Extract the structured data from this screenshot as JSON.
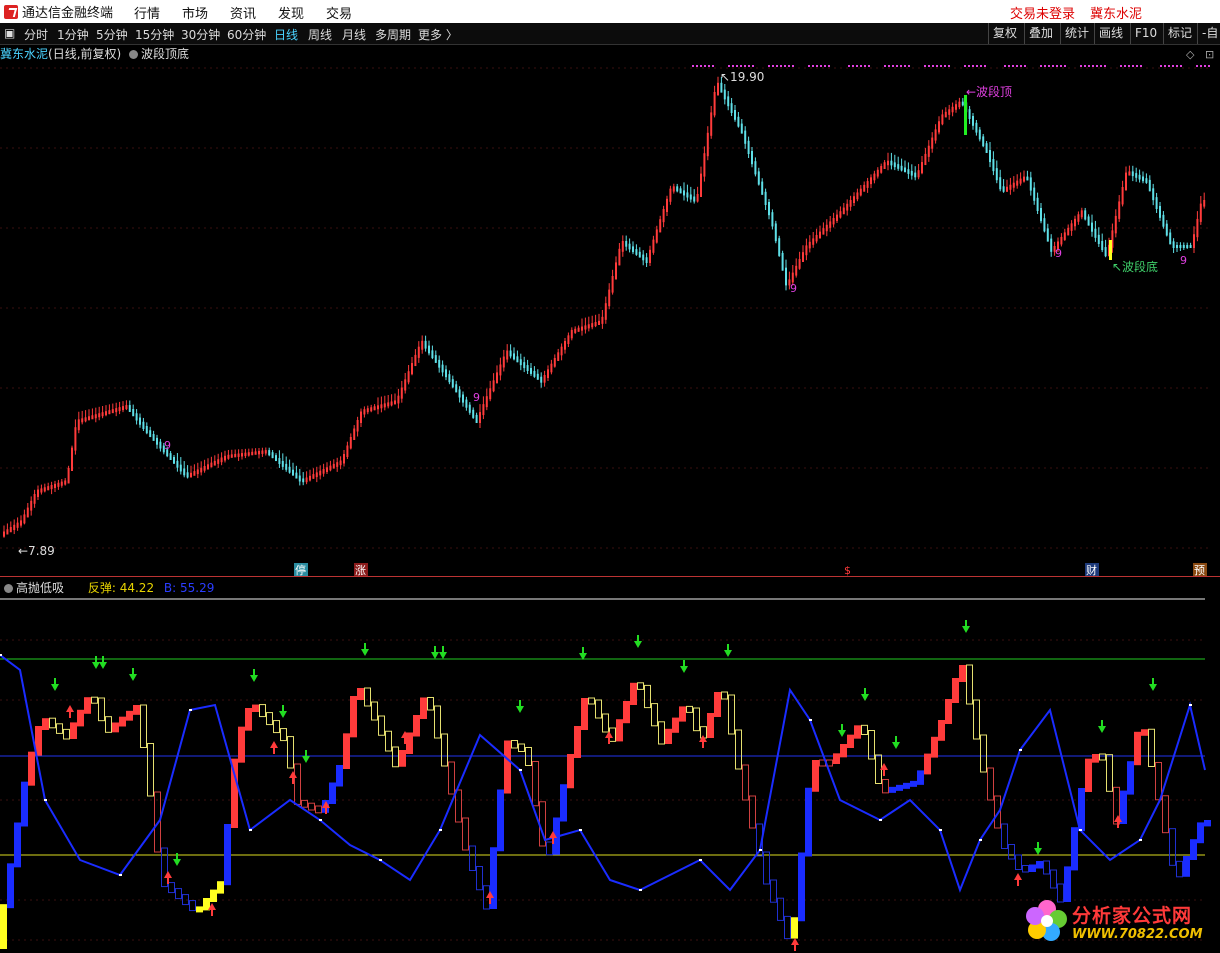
{
  "app": {
    "title": "通达信金融终端"
  },
  "menu": [
    "行情",
    "市场",
    "资讯",
    "发现",
    "交易"
  ],
  "top_right": {
    "login_status": "交易未登录",
    "stock_name": "冀东水泥"
  },
  "toolbar": {
    "periods": [
      "分时",
      "1分钟",
      "5分钟",
      "15分钟",
      "30分钟",
      "60分钟",
      "日线",
      "周线",
      "月线",
      "多周期",
      "更多 〉"
    ],
    "active_period": "日线",
    "right_buttons": [
      "复权",
      "叠加",
      "统计",
      "画线",
      "F10",
      "标记",
      "-自"
    ]
  },
  "main_panel": {
    "stock_label": "冀东水泥",
    "mode": "(日线,前复权)",
    "indicator": "波段顶底",
    "high_label": "19.90",
    "low_label": "7.89",
    "top_marker": "←波段顶",
    "bottom_marker": "↖波段底",
    "nine_mark": "9",
    "event_badges": [
      "停",
      "涨",
      "$",
      "财",
      "预"
    ]
  },
  "sub_panel": {
    "indicator": "高抛低吸",
    "rebound_label": "反弹:",
    "rebound_value": "44.22",
    "b_label": "B:",
    "b_value": "55.29"
  },
  "colors": {
    "up": "#ff3b3b",
    "down": "#5fe0e8",
    "blue_line": "#1a2cff",
    "yellow": "#ffff20",
    "green": "#22dd22",
    "magenta": "#e040e0",
    "accent_cyan": "#4ad3ff"
  },
  "watermark": {
    "site": "分析家公式网",
    "url": "WWW.70822.COM"
  }
}
